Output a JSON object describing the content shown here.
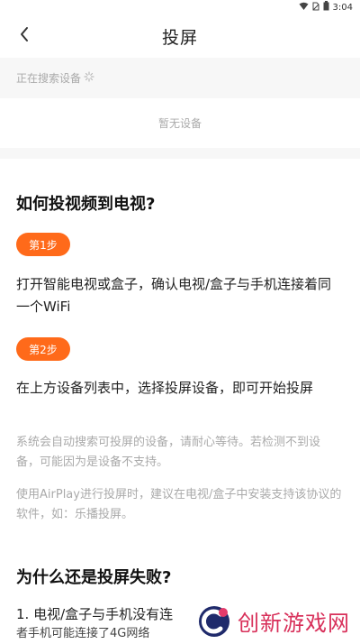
{
  "status_bar": {
    "time": "3:04"
  },
  "header": {
    "title": "投屏"
  },
  "search": {
    "status_text": "正在搜索设备"
  },
  "devices": {
    "empty_text": "暂无设备"
  },
  "guide": {
    "title": "如何投视频到电视?",
    "steps": [
      {
        "badge": "第1步",
        "text": "打开智能电视或盒子，确认电视/盒子与手机连接着同一个WiFi"
      },
      {
        "badge": "第2步",
        "text": "在上方设备列表中，选择投屏设备，即可开始投屏"
      }
    ],
    "notes": [
      "系统会自动搜索可投屏的设备，请耐心等待。若检测不到设备，可能因为是设备不支持。",
      "使用AirPlay进行投屏时，建议在电视/盒子中安装支持该协议的软件，如：乐播投屏。"
    ]
  },
  "failure": {
    "title": "为什么还是投屏失败?",
    "items": [
      "1. 电视/盒子与手机没有连",
      "者手机可能连接了4G网络"
    ]
  },
  "watermark": {
    "text": "创新游戏网"
  }
}
